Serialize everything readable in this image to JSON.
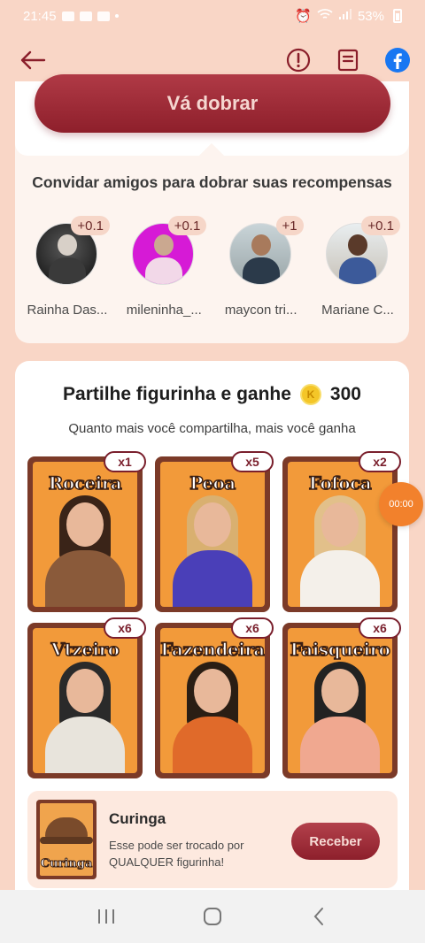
{
  "status_bar": {
    "time": "21:45",
    "battery": "53%"
  },
  "header": {
    "back_icon": "arrow-left-icon",
    "report_icon": "alert-circle-icon",
    "rules_icon": "document-icon",
    "facebook_icon": "facebook-icon"
  },
  "invite": {
    "double_button": "Vá dobrar",
    "title": "Convidar amigos para dobrar suas recompensas",
    "friends": [
      {
        "name": "Rainha Das...",
        "bonus": "+0.1"
      },
      {
        "name": "mileninha_...",
        "bonus": "+0.1"
      },
      {
        "name": "maycon tri...",
        "bonus": "+1"
      },
      {
        "name": "Mariane C...",
        "bonus": "+0.1"
      }
    ]
  },
  "share": {
    "title": "Partilhe figurinha e ganhe",
    "coin_symbol": "K",
    "reward": "300",
    "subtitle": "Quanto mais você compartilha, mais você ganha",
    "stickers": [
      {
        "label": "Roceira",
        "count": "x1",
        "hair": "#3a2418",
        "outfit": "#8a5a3a"
      },
      {
        "label": "Peoa",
        "count": "x5",
        "hair": "#d9b070",
        "outfit": "#4a3fb8"
      },
      {
        "label": "Fofoca",
        "count": "x2",
        "hair": "#e2c08a",
        "outfit": "#f4f0ea"
      },
      {
        "label": "Vtzeiro",
        "count": "x6",
        "hair": "#2a2a2a",
        "outfit": "#e8e4dc"
      },
      {
        "label": "Fazendeira",
        "count": "x6",
        "hair": "#2a1e14",
        "outfit": "#e06a2a"
      },
      {
        "label": "Faisqueiro",
        "count": "x6",
        "hair": "#222222",
        "outfit": "#f0a890"
      }
    ],
    "joker": {
      "thumb_label": "Curinga",
      "title": "Curinga",
      "description": "Esse pode ser trocado por QUALQUER figurinha!",
      "button": "Receber"
    }
  },
  "timer": "00:00",
  "colors": {
    "accent": "#9a2a36",
    "background": "#f9d6c6",
    "timer": "#f2812c"
  }
}
